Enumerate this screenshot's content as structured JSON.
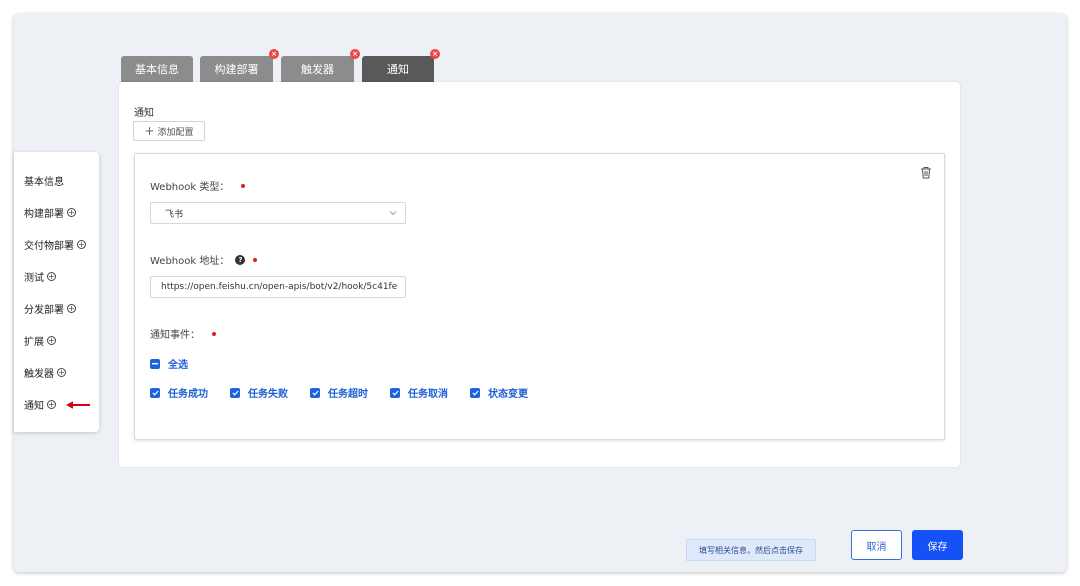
{
  "tabs": [
    {
      "label": "基本信息",
      "active": false,
      "error": false
    },
    {
      "label": "构建部署",
      "active": false,
      "error": true
    },
    {
      "label": "触发器",
      "active": false,
      "error": true
    },
    {
      "label": "通知",
      "active": true,
      "error": true
    }
  ],
  "tab_error_mark": "×",
  "notify": {
    "section_title": "通知",
    "add_button": {
      "icon": "plus-icon",
      "label": "添加配置"
    },
    "delete_icon": "trash-icon",
    "webhook_type": {
      "label": "Webhook 类型：",
      "value": "飞书"
    },
    "webhook_url": {
      "label": "Webhook 地址：",
      "help_icon": "?",
      "value": "https://open.feishu.cn/open-apis/bot/v2/hook/5c41fe"
    },
    "events": {
      "label": "通知事件：",
      "select_all": "全选",
      "items": [
        "任务成功",
        "任务失败",
        "任务超时",
        "任务取消",
        "状态变更"
      ]
    }
  },
  "leftnav": {
    "items": [
      {
        "label": "基本信息",
        "expandable": false
      },
      {
        "label": "构建部署",
        "expandable": true
      },
      {
        "label": "交付物部署",
        "expandable": true
      },
      {
        "label": "测试",
        "expandable": true
      },
      {
        "label": "分发部署",
        "expandable": true
      },
      {
        "label": "扩展",
        "expandable": true
      },
      {
        "label": "触发器",
        "expandable": true
      },
      {
        "label": "通知",
        "expandable": true
      }
    ],
    "expand_symbol": "+"
  },
  "footer": {
    "hint": "填写相关信息，然后点击保存",
    "cancel": "取消",
    "save": "保存"
  },
  "colors": {
    "primary": "#1551f5",
    "required": "#e02020",
    "arrow": "#d0021b"
  }
}
